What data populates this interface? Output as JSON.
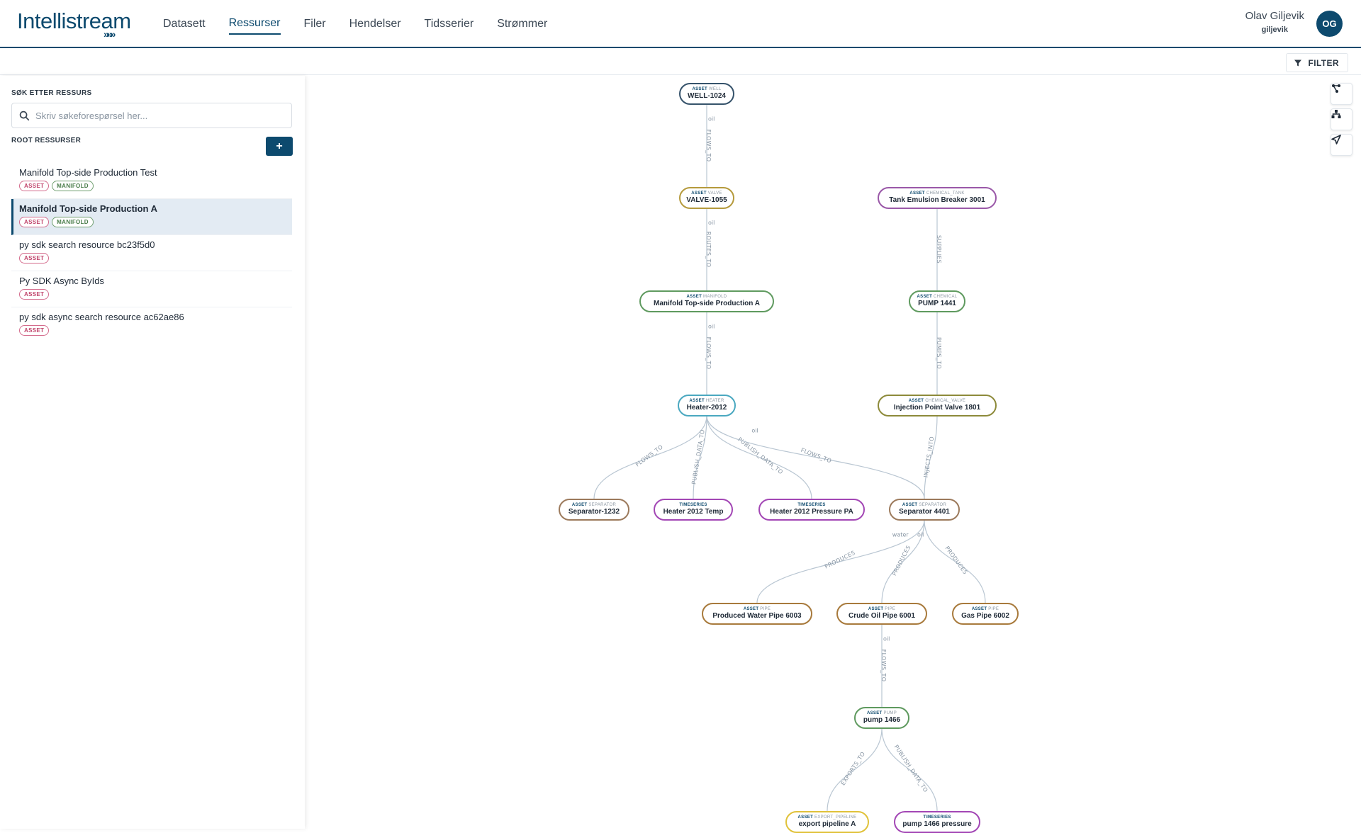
{
  "app": {
    "logo_text": "Intellistream",
    "logo_chevrons": "»»»",
    "nav": [
      "Datasett",
      "Ressurser",
      "Filer",
      "Hendelser",
      "Tidsserier",
      "Strømmer"
    ],
    "active_nav": "Ressurser",
    "user": {
      "name": "Olav Giljevik",
      "handle": "giljevik",
      "initials": "OG"
    }
  },
  "toolbar": {
    "filter_label": "FILTER"
  },
  "sidebar": {
    "search_label": "SØK ETTER RESSURS",
    "search_placeholder": "Skriv søkeforespørsel her...",
    "root_label": "ROOT RESSURSER",
    "add_label": "+",
    "items": [
      {
        "name": "Manifold Top-side Production Test",
        "tags": [
          "ASSET",
          "MANIFOLD"
        ],
        "selected": false
      },
      {
        "name": "Manifold Top-side Production A",
        "tags": [
          "ASSET",
          "MANIFOLD"
        ],
        "selected": true
      },
      {
        "name": "py sdk search resource bc23f5d0",
        "tags": [
          "ASSET"
        ],
        "selected": false
      },
      {
        "name": "Py SDK Async ByIds",
        "tags": [
          "ASSET"
        ],
        "selected": false
      },
      {
        "name": "py sdk async search resource ac62ae86",
        "tags": [
          "ASSET"
        ],
        "selected": false
      }
    ]
  },
  "graph": {
    "nodes": [
      {
        "id": "n1",
        "kind": "ASSET",
        "sub": "WELL",
        "name": "WELL-1024",
        "color": "#36536b"
      },
      {
        "id": "n2",
        "kind": "ASSET",
        "sub": "VALVE",
        "name": "VALVE-1055",
        "color": "#b59a3c"
      },
      {
        "id": "n3",
        "kind": "ASSET",
        "sub": "CHEMICAL_TANK",
        "name": "Tank Emulsion Breaker 3001",
        "color": "#9a58a8"
      },
      {
        "id": "n4",
        "kind": "ASSET",
        "sub": "MANIFOLD",
        "name": "Manifold Top-side Production A",
        "color": "#5f9a5f"
      },
      {
        "id": "n5",
        "kind": "ASSET",
        "sub": "CHEMICAL",
        "name": "PUMP 1441",
        "color": "#5f9a5f"
      },
      {
        "id": "n6",
        "kind": "ASSET",
        "sub": "HEATER",
        "name": "Heater-2012",
        "color": "#4aa8c0"
      },
      {
        "id": "n7",
        "kind": "ASSET",
        "sub": "CHEMICAL_VALVE",
        "name": "Injection Point Valve 1801",
        "color": "#8d8a3a"
      },
      {
        "id": "n8",
        "kind": "ASSET",
        "sub": "SEPARATOR",
        "name": "Separator-1232",
        "color": "#9c7a5c"
      },
      {
        "id": "n9",
        "kind": "TIMESERIES",
        "sub": "",
        "name": "Heater 2012 Temp",
        "color": "#a347b5"
      },
      {
        "id": "n10",
        "kind": "TIMESERIES",
        "sub": "",
        "name": "Heater 2012 Pressure PA",
        "color": "#a347b5"
      },
      {
        "id": "n11",
        "kind": "ASSET",
        "sub": "SEPARATOR",
        "name": "Separator 4401",
        "color": "#9c7a5c"
      },
      {
        "id": "n12",
        "kind": "ASSET",
        "sub": "PIPE",
        "name": "Produced Water Pipe 6003",
        "color": "#a87a3c"
      },
      {
        "id": "n13",
        "kind": "ASSET",
        "sub": "PIPE",
        "name": "Crude Oil Pipe 6001",
        "color": "#a87a3c"
      },
      {
        "id": "n14",
        "kind": "ASSET",
        "sub": "PIPE",
        "name": "Gas Pipe 6002",
        "color": "#a87a3c"
      },
      {
        "id": "n15",
        "kind": "ASSET",
        "sub": "PUMP",
        "name": "pump 1466",
        "color": "#5f9a5f"
      },
      {
        "id": "n16",
        "kind": "ASSET",
        "sub": "EXPORT_PIPELINE",
        "name": "export pipeline A",
        "color": "#e0c23a"
      },
      {
        "id": "n17",
        "kind": "TIMESERIES",
        "sub": "",
        "name": "pump 1466 pressure",
        "color": "#a347b5"
      }
    ],
    "edges": [
      {
        "label": "FLOWS_TO",
        "extra": "oil"
      },
      {
        "label": "ROUTES_TO",
        "extra": "oil"
      },
      {
        "label": "SUPPLIES",
        "extra": ""
      },
      {
        "label": "FLOWS_TO",
        "extra": "oil"
      },
      {
        "label": "PUMPS_TO",
        "extra": ""
      },
      {
        "label": "FLOWS_TO",
        "extra": ""
      },
      {
        "label": "PUBLISH_DATA_TO",
        "extra": ""
      },
      {
        "label": "PUBLISH_DATA_TO",
        "extra": ""
      },
      {
        "label": "FLOWS_TO",
        "extra": "oil"
      },
      {
        "label": "INJECTS_INTO",
        "extra": ""
      },
      {
        "label": "PRODUCES",
        "extra": "water"
      },
      {
        "label": "PRODUCES",
        "extra": "oil"
      },
      {
        "label": "PRODUCES",
        "extra": ""
      },
      {
        "label": "FLOWS_TO",
        "extra": "oil"
      },
      {
        "label": "EXPORTS_TO",
        "extra": ""
      },
      {
        "label": "PUBLISH_DATA_TO",
        "extra": ""
      }
    ]
  }
}
